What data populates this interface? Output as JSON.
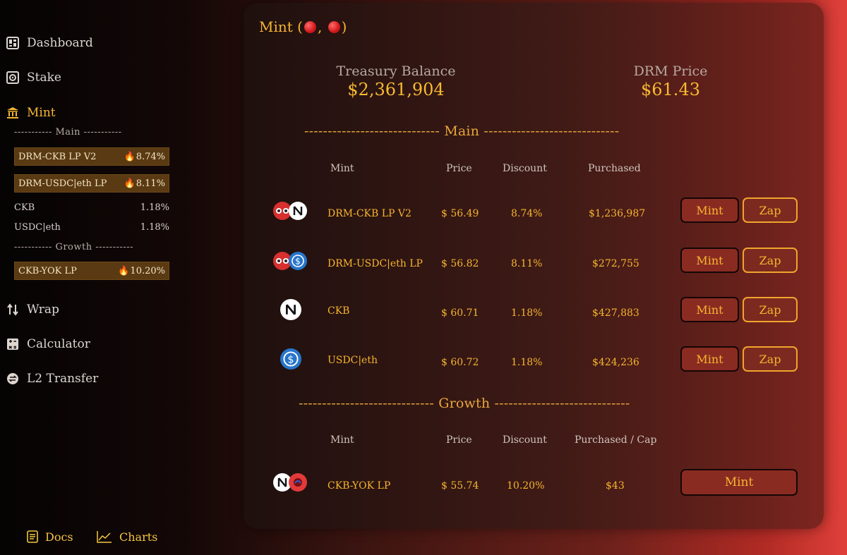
{
  "sidebar": {
    "nav": [
      {
        "label": "Dashboard",
        "icon": "dashboard-icon"
      },
      {
        "label": "Stake",
        "icon": "safe-icon"
      },
      {
        "label": "Mint",
        "icon": "bank-icon"
      },
      {
        "label": "Wrap",
        "icon": "swap-vertical-icon"
      },
      {
        "label": "Calculator",
        "icon": "calculator-icon"
      },
      {
        "label": "L2 Transfer",
        "icon": "transfer-icon"
      }
    ],
    "main_divider": "----------- Main -----------",
    "growth_divider": "----------- Growth -----------",
    "main_items": [
      {
        "label": "DRM-CKB LP V2",
        "value": "8.74%",
        "hot": "🔥"
      },
      {
        "label": "DRM-USDC|eth LP",
        "value": "8.11%",
        "hot": "🔥"
      },
      {
        "label": "CKB",
        "value": "1.18%"
      },
      {
        "label": "USDC|eth",
        "value": "1.18%"
      }
    ],
    "growth_items": [
      {
        "label": "CKB-YOK LP",
        "value": "10.20%",
        "hot": "🔥"
      }
    ],
    "footer": {
      "docs": "Docs",
      "charts": "Charts"
    }
  },
  "card": {
    "title": "Mint (",
    "title_sep": ", ",
    "title_end": ")",
    "treasury_label": "Treasury Balance",
    "treasury_value": "$2,361,904",
    "price_label": "DRM Price",
    "price_value": "$61.43",
    "main_section": "----------------------------- Main -----------------------------",
    "growth_section": "----------------------------- Growth -----------------------------",
    "main_headers": {
      "mint": "Mint",
      "price": "Price",
      "discount": "Discount",
      "purchased": "Purchased"
    },
    "growth_headers": {
      "mint": "Mint",
      "price": "Price",
      "discount": "Discount",
      "purchased": "Purchased / Cap"
    },
    "main_rows": [
      {
        "name": "DRM-CKB LP V2",
        "price": "$ 56.49",
        "discount": "8.74%",
        "purchased": "$1,236,987",
        "icons": [
          "drm-icon",
          "ckb-icon"
        ]
      },
      {
        "name": "DRM-USDC|eth LP",
        "price": "$ 56.82",
        "discount": "8.11%",
        "purchased": "$272,755",
        "icons": [
          "drm-icon",
          "usdc-icon"
        ]
      },
      {
        "name": "CKB",
        "price": "$ 60.71",
        "discount": "1.18%",
        "purchased": "$427,883",
        "icons": [
          "ckb-icon"
        ]
      },
      {
        "name": "USDC|eth",
        "price": "$ 60.72",
        "discount": "1.18%",
        "purchased": "$424,236",
        "icons": [
          "usdc-icon"
        ]
      }
    ],
    "growth_rows": [
      {
        "name": "CKB-YOK LP",
        "price": "$ 55.74",
        "discount": "10.20%",
        "purchased": "$43",
        "icons": [
          "ckb-icon",
          "yok-icon"
        ]
      }
    ],
    "mint_label": "Mint",
    "zap_label": "Zap"
  }
}
